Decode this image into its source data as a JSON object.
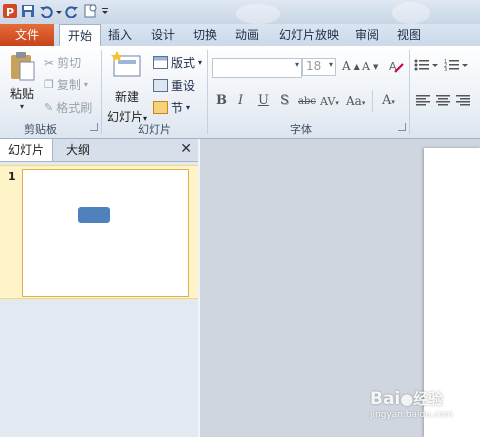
{
  "quick_access": {
    "app_icon": "powerpoint-icon",
    "buttons": [
      "save-icon",
      "undo-icon",
      "redo-icon",
      "new-slide-icon",
      "customize-dropdown-icon"
    ]
  },
  "tabs": [
    {
      "label": "文件",
      "active": false
    },
    {
      "label": "开始",
      "active": true
    },
    {
      "label": "插入",
      "active": false
    },
    {
      "label": "设计",
      "active": false
    },
    {
      "label": "切换",
      "active": false
    },
    {
      "label": "动画",
      "active": false
    },
    {
      "label": "幻灯片放映",
      "active": false
    },
    {
      "label": "审阅",
      "active": false
    },
    {
      "label": "视图",
      "active": false
    }
  ],
  "clipboard": {
    "paste": "粘贴",
    "cut": "剪切",
    "copy": "复制",
    "format_painter": "格式刷",
    "group_label": "剪贴板"
  },
  "slides_group": {
    "new_slide_line1": "新建",
    "new_slide_line2": "幻灯片",
    "layout": "版式",
    "reset": "重设",
    "section": "节",
    "group_label": "幻灯片"
  },
  "font_group": {
    "font_name": "",
    "font_size": "18",
    "group_label": "字体",
    "format_buttons": [
      "B",
      "I",
      "U",
      "S",
      "abc",
      "AV",
      "Aa",
      "A"
    ]
  },
  "left_pane": {
    "tab_slides": "幻灯片",
    "tab_outline": "大纲",
    "close": "✕",
    "slide_number": "1"
  },
  "watermark": {
    "brand": "Bai",
    "brand_tail": "经验",
    "url": "jingyan.baidu.com"
  },
  "colors": {
    "file_tab": "#d2542a",
    "ribbon_bg": "#e9eef5",
    "thumb_highlight": "#fff3c8",
    "shape_blue": "#4f81bd"
  }
}
